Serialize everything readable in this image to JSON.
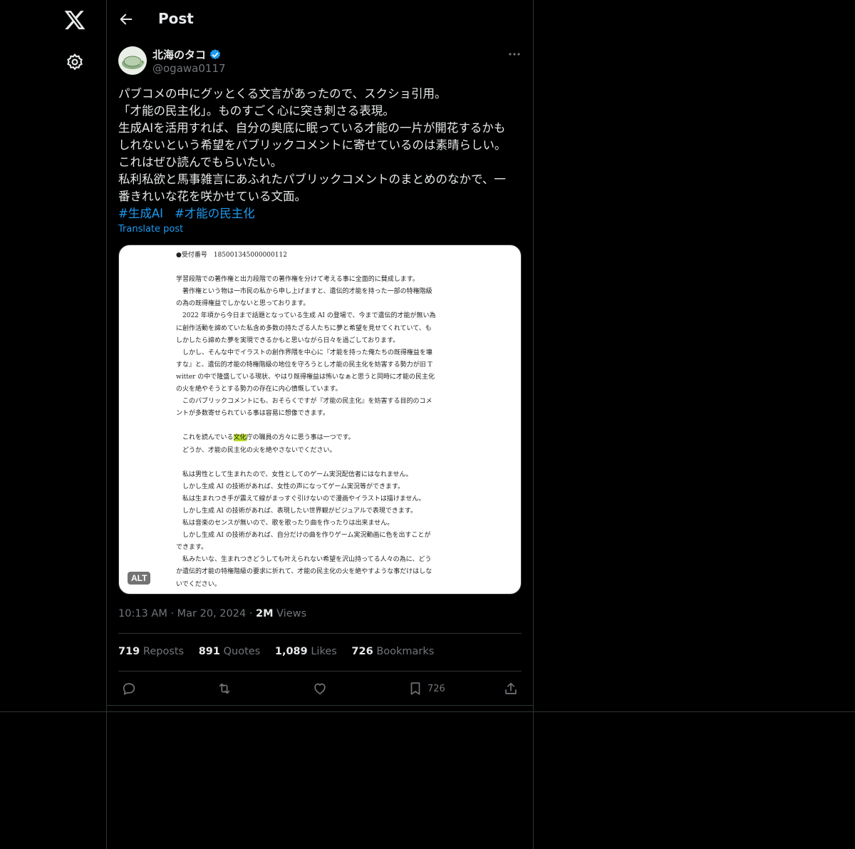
{
  "nav": {
    "logo_icon": "x-logo-icon",
    "settings_icon": "gear-icon"
  },
  "header": {
    "title": "Post",
    "back_icon": "arrow-left-icon"
  },
  "author": {
    "name": "北海のタコ",
    "handle": "@ogawa0117",
    "verified": true,
    "avatar_icon": "turtle-avatar"
  },
  "post": {
    "lines": [
      "パブコメの中にグッとくる文言があったので、スクショ引用。",
      "「才能の民主化」。ものすごく心に突き刺さる表現。",
      "生成AIを活用すれば、自分の奥底に眠っている才能の一片が開花するかも",
      "しれないという希望をパブリックコメントに寄せているのは素晴らしい。",
      "これはぜひ読んでもらいたい。",
      "私利私欲と馬事雑言にあふれたパブリックコメントのまとめのなかで、一",
      "番きれいな花を咲かせている文面。"
    ],
    "hashtags": [
      "#生成AI",
      "#才能の民主化"
    ],
    "translate": "Translate post"
  },
  "media": {
    "alt_badge": "ALT",
    "doc_lines": [
      "●受付番号　185001345000000112",
      "",
      "学習段階での著作権と出力段階での著作権を分けて考える事に全面的に賛成します。",
      "　著作権という物は一市民の私から申し上げますと、遺伝的才能を持った一部の特権階級",
      "の為の既得権益でしかないと思っております。",
      "　2022 年頃から今日まで話題となっている生成 AI の登場で、今まで遺伝的才能が無い為",
      "に創作活動を諦めていた私含め多数の持たざる人たちに夢と希望を見せてくれていて、も",
      "しかしたら諦めた夢を実現できるかもと思いながら日々を過ごしております。",
      "　しかし、そんな中でイラストの創作界隈を中心に『才能を持った俺たちの既得権益を壊",
      "すな』と、遺伝的才能の特権階級の地位を守ろうとし才能の民主化を妨害する勢力が旧 T",
      "witter の中で隆盛している現状、やはり既得権益は怖いなぁと思うと同時に才能の民主化",
      "の火を絶やそうとする勢力の存在に内心憤慨しています。",
      "　このパブリックコメントにも、おそらくですが『才能の民主化』を妨害する目的のコメ",
      "ントが多数寄せられている事は容易に想像できます。",
      "",
      "　これを読んでいる文化庁の職員の方々に思う事は一つです。",
      "　どうか、才能の民主化の火を絶やさないでください。",
      "",
      "　私は男性として生まれたので、女性としてのゲーム実況配信者にはなれません。",
      "　しかし生成 AI の技術があれば、女性の声になってゲーム実況等ができます。",
      "　私は生まれつき手が震えて線がまっすぐ引けないので漫画やイラストは描けません。",
      "　しかし生成 AI の技術があれば、表現したい世界観がビジュアルで表現できます。",
      "　私は音楽のセンスが無いので、歌を歌ったり曲を作ったりは出来ません。",
      "　しかし生成 AI の技術があれば、自分だけの曲を作りゲーム実況動画に色を出すことが",
      "できます。",
      "　私みたいな、生まれつきどうしても叶えられない希望を沢山持ってる人々の為に、どう",
      "か遺伝的才能の特権階級の要求に折れて、才能の民主化の火を絶やすような事だけはしな",
      "いでください。"
    ]
  },
  "meta": {
    "time": "10:13 AM",
    "date": "Mar 20, 2024",
    "views_count": "2M",
    "views_label": "Views"
  },
  "stats": {
    "reposts_count": "719",
    "reposts_label": "Reposts",
    "quotes_count": "891",
    "quotes_label": "Quotes",
    "likes_count": "1,089",
    "likes_label": "Likes",
    "bookmarks_count": "726",
    "bookmarks_label": "Bookmarks"
  },
  "actions": {
    "reply_icon": "reply-icon",
    "repost_icon": "repost-icon",
    "like_icon": "heart-icon",
    "bookmark_icon": "bookmark-icon",
    "bookmark_count": "726",
    "share_icon": "share-icon"
  },
  "colors": {
    "background": "#000000",
    "accent": "#1d9bf0",
    "muted": "#71767b",
    "border": "#2f3336",
    "highlight": "#b5dd2a"
  }
}
